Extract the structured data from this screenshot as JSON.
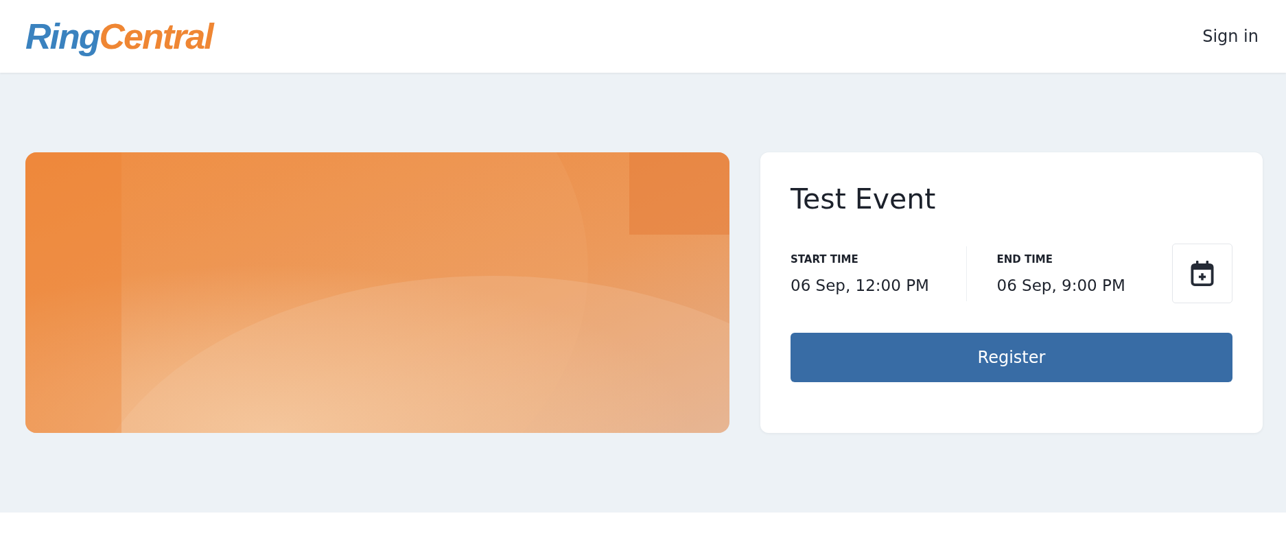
{
  "header": {
    "logo": [
      {
        "text": "Ring",
        "color": "#3a82bf"
      },
      {
        "text": "Central",
        "color": "#ef8633"
      }
    ],
    "sign_in": "Sign in"
  },
  "event": {
    "title": "Test Event",
    "times": [
      {
        "label": "START TIME",
        "value": "06 Sep, 12:00 PM"
      },
      {
        "label": "END TIME",
        "value": "06 Sep, 9:00 PM"
      }
    ],
    "register": "Register"
  }
}
